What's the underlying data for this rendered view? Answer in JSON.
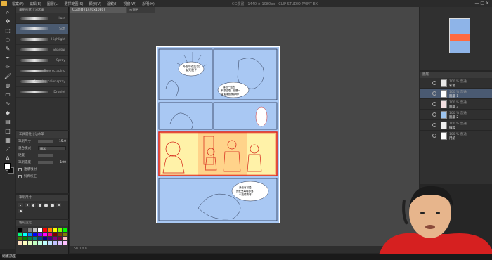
{
  "menubar": {
    "items": [
      "檔案(F)",
      "編輯(E)",
      "圖層(L)",
      "選擇範圍(S)",
      "顯示(V)",
      "濾鏡(I)",
      "視窗(W)",
      "說明(H)"
    ],
    "title": "CG漫畫 - 1440 × 1080px - CLIP STUDIO PAINT EX",
    "window_controls": "— □ ×"
  },
  "subtool": {
    "header": "筆刷形狀 | 沾水筆",
    "brushes": [
      {
        "label": "Hard"
      },
      {
        "label": "Soft"
      },
      {
        "label": "Highlight"
      },
      {
        "label": "Shadow"
      },
      {
        "label": "Spray"
      },
      {
        "label": "Tone scraping"
      },
      {
        "label": "Running color spray"
      },
      {
        "label": "Droplet"
      }
    ]
  },
  "toolprop": {
    "header": "工具屬性 | 沾水筆",
    "rows": [
      {
        "key": "筆刷尺寸",
        "value": "15.0"
      },
      {
        "key": "混合模式",
        "value": "通常"
      },
      {
        "key": "硬度",
        "value": ""
      },
      {
        "key": "筆刷濃度",
        "value": "100"
      }
    ],
    "check1": "連續噴射",
    "check2": "對齊校正"
  },
  "brushsize": {
    "header": "筆刷尺寸"
  },
  "colorset": {
    "header": "色彩設定",
    "colors": [
      "#000000",
      "#404040",
      "#808080",
      "#c0c0c0",
      "#ffffff",
      "#ff0000",
      "#ff8000",
      "#ffff00",
      "#80ff00",
      "#00ff00",
      "#00ff80",
      "#00ffff",
      "#0080ff",
      "#0000ff",
      "#8000ff",
      "#ff00ff",
      "#ff0080",
      "#800000",
      "#804000",
      "#808000",
      "#408000",
      "#008000",
      "#008040",
      "#008080",
      "#004080",
      "#000080",
      "#400080",
      "#800080",
      "#800040",
      "#ffc0c0",
      "#ffe0c0",
      "#ffffc0",
      "#e0ffc0",
      "#c0ffc0",
      "#c0ffe0",
      "#c0ffff",
      "#c0e0ff",
      "#c0c0ff",
      "#e0c0ff",
      "#ffc0ff"
    ]
  },
  "canvas": {
    "tab_label": "CG漫畫 (1440x1080)",
    "tab2_label": "未命名",
    "status": "50.0   0.0"
  },
  "comic": {
    "bubble1": "外面牛在打架\n嚇死我了",
    "bubble2": "喜歡一點也\n不想結婚，但是一\n直這樣很寂寞啊?",
    "bubble3": "我也有可愛\n的女兒每時部落\n么能想再呀?"
  },
  "layers": {
    "header": "圖層",
    "items": [
      {
        "line1": "100 % 普通",
        "line2": "彩色",
        "selected": false,
        "thumb": "#e8e8e8"
      },
      {
        "line1": "100 % 普通",
        "line2": "圖層 1",
        "selected": true,
        "thumb": "#ffffff"
      },
      {
        "line1": "100 % 普通",
        "line2": "圖層 3",
        "selected": false,
        "thumb": "#f2dfe0"
      },
      {
        "line1": "100 % 普通",
        "line2": "圖層 2",
        "selected": false,
        "thumb": "#9cc3ee"
      },
      {
        "line1": "100 % 普通",
        "line2": "線稿",
        "selected": false,
        "thumb": "#eeeeee"
      },
      {
        "line1": "100 % 普通",
        "line2": "用紙",
        "selected": false,
        "thumb": "#ffffff"
      }
    ]
  },
  "taskbar": {
    "label": "繪畫講座"
  }
}
